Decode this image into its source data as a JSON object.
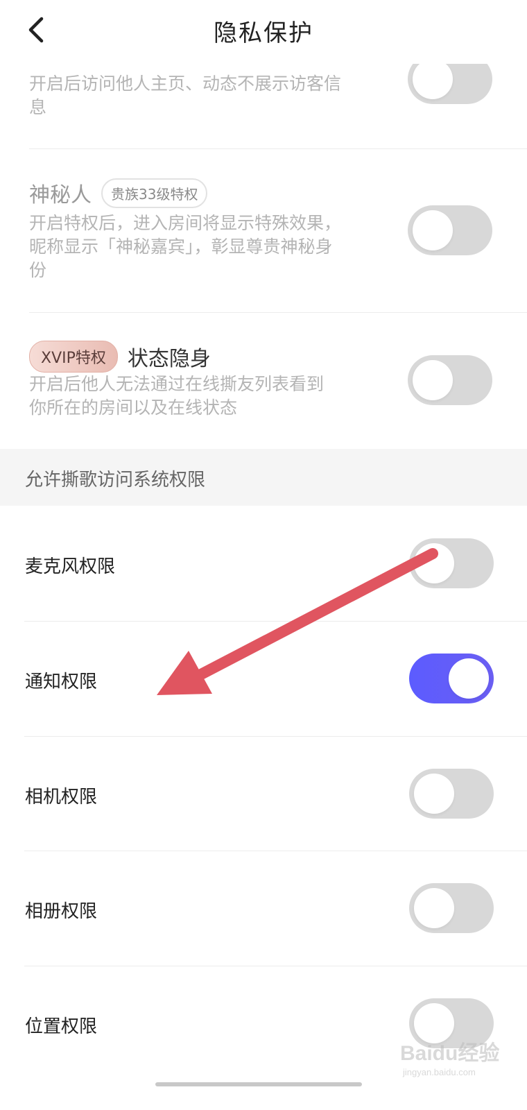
{
  "header": {
    "title": "隐私保护"
  },
  "privacy_items": [
    {
      "title": "",
      "badge": "",
      "desc_line1": "开启后访问他人主页、动态不展示访客信",
      "desc_line2": "息",
      "toggle_on": false
    },
    {
      "title": "神秘人",
      "badge": "贵族33级特权",
      "desc_line1": "开启特权后，进入房间将显示特殊效果，",
      "desc_line2": "昵称显示「神秘嘉宾」，彰显尊贵神秘身",
      "desc_line3": "份",
      "toggle_on": false
    },
    {
      "title": "状态隐身",
      "badge": "XVIP特权",
      "desc_line1": "开启后他人无法通过在线撕友列表看到",
      "desc_line2": "你所在的房间以及在线状态",
      "toggle_on": false
    }
  ],
  "section": {
    "title": "允许撕歌访问系统权限"
  },
  "permissions": [
    {
      "label": "麦克风权限",
      "toggle_on": false
    },
    {
      "label": "通知权限",
      "toggle_on": true
    },
    {
      "label": "相机权限",
      "toggle_on": false
    },
    {
      "label": "相册权限",
      "toggle_on": false
    },
    {
      "label": "位置权限",
      "toggle_on": false
    }
  ],
  "colors": {
    "toggle_on": "#5c5cff",
    "toggle_off": "#d8d8d8",
    "annotation_arrow": "#e05560"
  },
  "icons": {
    "back": "chevron-left-icon"
  },
  "watermark": {
    "text": "Baidu经验",
    "sub": "jingyan.baidu.com"
  }
}
